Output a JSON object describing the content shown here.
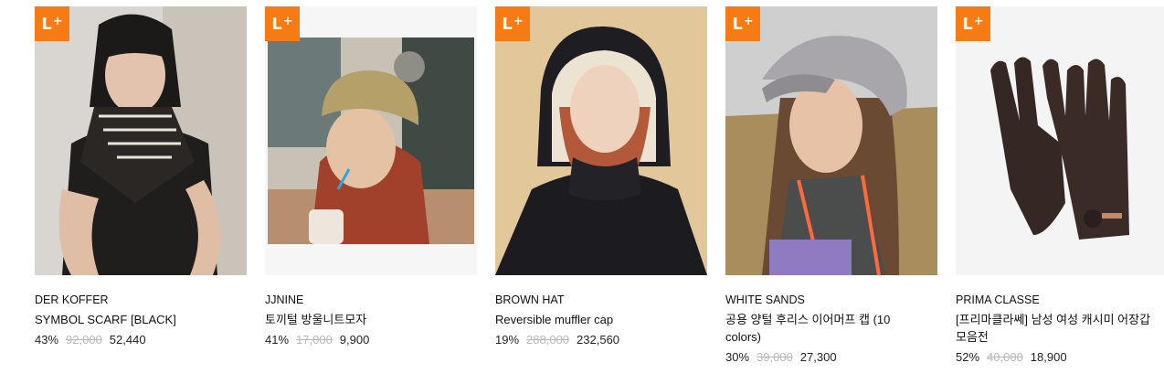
{
  "badge": {
    "label": "L",
    "plus": "+"
  },
  "products": [
    {
      "brand": "DER KOFFER",
      "name": "SYMBOL SCARF [BLACK]",
      "discount": "43%",
      "original_price": "92,000",
      "sale_price": "52,440"
    },
    {
      "brand": "JJNINE",
      "name": "토끼털 방울니트모자",
      "discount": "41%",
      "original_price": "17,000",
      "sale_price": "9,900"
    },
    {
      "brand": "BROWN HAT",
      "name": "Reversible muffler cap",
      "discount": "19%",
      "original_price": "288,000",
      "sale_price": "232,560"
    },
    {
      "brand": "WHITE SANDS",
      "name": "공용 양털 후리스 이어머프 캡 (10 colors)",
      "discount": "30%",
      "original_price": "39,000",
      "sale_price": "27,300"
    },
    {
      "brand": "PRIMA CLASSE",
      "name": "[프리마클라쎄] 남성 여성 캐시미 어장갑 모음전",
      "discount": "52%",
      "original_price": "40,000",
      "sale_price": "18,900"
    }
  ],
  "colors": {
    "badge": "#f77b15",
    "strike": "#b8b8b8"
  }
}
